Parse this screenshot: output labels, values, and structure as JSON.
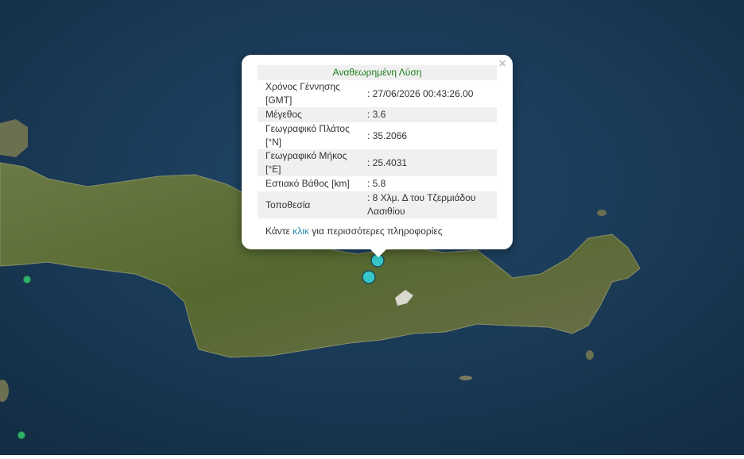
{
  "popup": {
    "title": "Αναθεωρημένη Λύση",
    "close_symbol": "×",
    "rows": [
      {
        "label": "Χρόνος Γέννησης [GMT]",
        "value": ": 27/06/2026 00:43:26.00"
      },
      {
        "label": "Μέγεθος",
        "value": ": 3.6"
      },
      {
        "label": "Γεωγραφικό Πλάτος [°N]",
        "value": ": 35.2066"
      },
      {
        "label": "Γεωγραφικό Μήκος [°E]",
        "value": ": 25.4031"
      },
      {
        "label": "Εστιακό Βάθος [km]",
        "value": ": 5.8"
      },
      {
        "label": "Τοποθεσία",
        "value": ": 8 Χλμ. Δ του Τζερμιάδου Λασιθίου"
      }
    ],
    "more_prefix": "Κάντε ",
    "more_link": "κλικ",
    "more_suffix": " για περισσότερες πληροφορίες"
  },
  "colors": {
    "sea": "#1c3d57",
    "land": "#566c36",
    "selected_marker": "#37c6c9",
    "other_marker": "#2fb36a",
    "title_text": "#1a7f1a",
    "link": "#2a8ab0"
  },
  "markers": {
    "selected_event": {
      "lat": 35.2066,
      "lon": 25.4031,
      "magnitude": 3.6
    }
  }
}
